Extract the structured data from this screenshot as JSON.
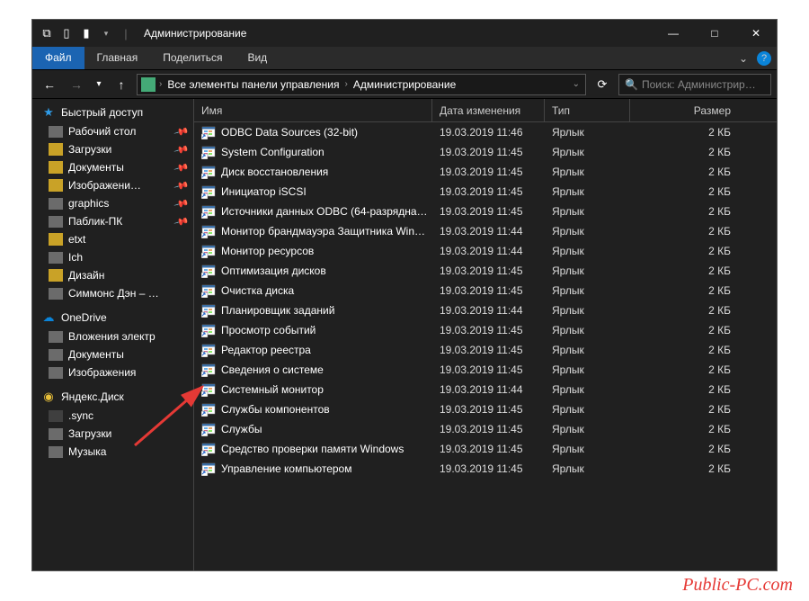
{
  "titlebar": {
    "title": "Администрирование",
    "min": "—",
    "max": "□",
    "close": "✕"
  },
  "ribbon": {
    "file": "Файл",
    "home": "Главная",
    "share": "Поделиться",
    "view": "Вид",
    "expand": "⌄",
    "help": "?"
  },
  "nav": {
    "back": "←",
    "fwd": "→",
    "down": "▾",
    "up": "↑",
    "crumb1": "Все элементы панели управления",
    "crumb2": "Администрирование",
    "refresh": "⟳"
  },
  "search": {
    "placeholder": "Поиск: Администрир…",
    "icon": "🔍"
  },
  "columns": {
    "name": "Имя",
    "date": "Дата изменения",
    "type": "Тип",
    "size": "Размер"
  },
  "sidebar": {
    "quick": "Быстрый доступ",
    "quick_items": [
      {
        "label": "Рабочий стол",
        "pin": true,
        "icon": "folder-closed"
      },
      {
        "label": "Загрузки",
        "pin": true,
        "icon": "folder"
      },
      {
        "label": "Документы",
        "pin": true,
        "icon": "folder"
      },
      {
        "label": "Изображени…",
        "pin": true,
        "icon": "folder"
      },
      {
        "label": "graphics",
        "pin": true,
        "icon": "folder-closed"
      },
      {
        "label": "Паблик-ПК",
        "pin": true,
        "icon": "folder-closed"
      },
      {
        "label": "etxt",
        "pin": false,
        "icon": "folder"
      },
      {
        "label": "Ich",
        "pin": false,
        "icon": "folder-closed"
      },
      {
        "label": "Дизайн",
        "pin": false,
        "icon": "folder"
      },
      {
        "label": "Симмонс Дэн – …",
        "pin": false,
        "icon": "folder-closed"
      }
    ],
    "onedrive": "OneDrive",
    "onedrive_items": [
      {
        "label": "Вложения электр"
      },
      {
        "label": "Документы"
      },
      {
        "label": "Изображения"
      }
    ],
    "yandex": "Яндекс.Диск",
    "yandex_items": [
      {
        "label": ".sync",
        "icon": "dark"
      },
      {
        "label": "Загрузки",
        "icon": "closed"
      },
      {
        "label": "Музыка",
        "icon": "closed"
      }
    ]
  },
  "files": [
    {
      "name": "ODBC Data Sources (32-bit)",
      "date": "19.03.2019 11:46",
      "type": "Ярлык",
      "size": "2 КБ"
    },
    {
      "name": "System Configuration",
      "date": "19.03.2019 11:45",
      "type": "Ярлык",
      "size": "2 КБ"
    },
    {
      "name": "Диск восстановления",
      "date": "19.03.2019 11:45",
      "type": "Ярлык",
      "size": "2 КБ"
    },
    {
      "name": "Инициатор iSCSI",
      "date": "19.03.2019 11:45",
      "type": "Ярлык",
      "size": "2 КБ"
    },
    {
      "name": "Источники данных ODBC (64-разрядна…",
      "date": "19.03.2019 11:45",
      "type": "Ярлык",
      "size": "2 КБ"
    },
    {
      "name": "Монитор брандмауэра Защитника Win…",
      "date": "19.03.2019 11:44",
      "type": "Ярлык",
      "size": "2 КБ"
    },
    {
      "name": "Монитор ресурсов",
      "date": "19.03.2019 11:44",
      "type": "Ярлык",
      "size": "2 КБ"
    },
    {
      "name": "Оптимизация дисков",
      "date": "19.03.2019 11:45",
      "type": "Ярлык",
      "size": "2 КБ"
    },
    {
      "name": "Очистка диска",
      "date": "19.03.2019 11:45",
      "type": "Ярлык",
      "size": "2 КБ"
    },
    {
      "name": "Планировщик заданий",
      "date": "19.03.2019 11:44",
      "type": "Ярлык",
      "size": "2 КБ"
    },
    {
      "name": "Просмотр событий",
      "date": "19.03.2019 11:45",
      "type": "Ярлык",
      "size": "2 КБ"
    },
    {
      "name": "Редактор реестра",
      "date": "19.03.2019 11:45",
      "type": "Ярлык",
      "size": "2 КБ"
    },
    {
      "name": "Сведения о системе",
      "date": "19.03.2019 11:45",
      "type": "Ярлык",
      "size": "2 КБ"
    },
    {
      "name": "Системный монитор",
      "date": "19.03.2019 11:44",
      "type": "Ярлык",
      "size": "2 КБ"
    },
    {
      "name": "Службы компонентов",
      "date": "19.03.2019 11:45",
      "type": "Ярлык",
      "size": "2 КБ"
    },
    {
      "name": "Службы",
      "date": "19.03.2019 11:45",
      "type": "Ярлык",
      "size": "2 КБ"
    },
    {
      "name": "Средство проверки памяти Windows",
      "date": "19.03.2019 11:45",
      "type": "Ярлык",
      "size": "2 КБ"
    },
    {
      "name": "Управление компьютером",
      "date": "19.03.2019 11:45",
      "type": "Ярлык",
      "size": "2 КБ"
    }
  ],
  "watermark": "Public-PC.com"
}
